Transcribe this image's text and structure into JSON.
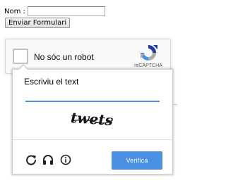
{
  "form": {
    "name_label": "Nom :",
    "submit_label": "Enviar Formulari"
  },
  "recaptcha": {
    "checkbox_label": "No sóc un robot",
    "logo_text": "reCAPTCHA",
    "challenge": {
      "title": "Escriviu el text",
      "captcha_text": "twets",
      "verify_label": "Verifica",
      "icons": [
        "reload-icon",
        "headphones-icon",
        "info-icon"
      ]
    }
  },
  "colors": {
    "accent": "#4a90e2",
    "anchor_bg": "#f9f9f9",
    "logo_blue": "#1c3aa9",
    "logo_light": "#4a90e2",
    "logo_gray": "#ababab"
  }
}
